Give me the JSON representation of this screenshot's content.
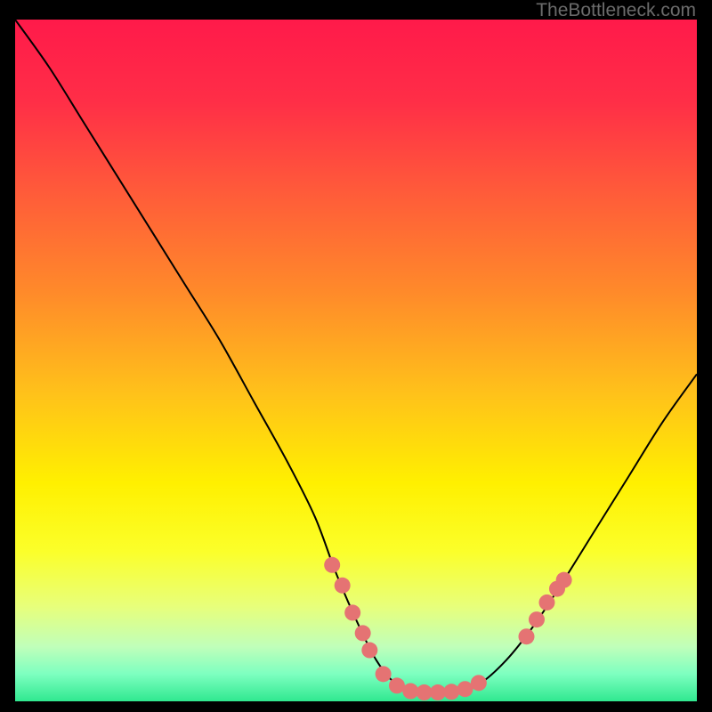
{
  "watermark": "TheBottleneck.com",
  "chart_data": {
    "type": "line",
    "xlim": [
      0,
      100
    ],
    "ylim": [
      0,
      100
    ],
    "curve": [
      {
        "x": 0,
        "y": 100
      },
      {
        "x": 5,
        "y": 93
      },
      {
        "x": 10,
        "y": 85
      },
      {
        "x": 15,
        "y": 77
      },
      {
        "x": 20,
        "y": 69
      },
      {
        "x": 25,
        "y": 61
      },
      {
        "x": 30,
        "y": 53
      },
      {
        "x": 35,
        "y": 44
      },
      {
        "x": 40,
        "y": 35
      },
      {
        "x": 44,
        "y": 27
      },
      {
        "x": 47,
        "y": 19
      },
      {
        "x": 50,
        "y": 12
      },
      {
        "x": 53,
        "y": 6
      },
      {
        "x": 56,
        "y": 2.5
      },
      {
        "x": 60,
        "y": 1.3
      },
      {
        "x": 64,
        "y": 1.3
      },
      {
        "x": 68,
        "y": 2.5
      },
      {
        "x": 72,
        "y": 6
      },
      {
        "x": 76,
        "y": 11
      },
      {
        "x": 80,
        "y": 17
      },
      {
        "x": 85,
        "y": 25
      },
      {
        "x": 90,
        "y": 33
      },
      {
        "x": 95,
        "y": 41
      },
      {
        "x": 100,
        "y": 48
      }
    ],
    "markers": [
      {
        "x": 46.5,
        "y": 20
      },
      {
        "x": 48,
        "y": 17
      },
      {
        "x": 49.5,
        "y": 13
      },
      {
        "x": 51,
        "y": 10
      },
      {
        "x": 52,
        "y": 7.5
      },
      {
        "x": 54,
        "y": 4
      },
      {
        "x": 56,
        "y": 2.3
      },
      {
        "x": 58,
        "y": 1.5
      },
      {
        "x": 60,
        "y": 1.3
      },
      {
        "x": 62,
        "y": 1.3
      },
      {
        "x": 64,
        "y": 1.4
      },
      {
        "x": 66,
        "y": 1.8
      },
      {
        "x": 68,
        "y": 2.7
      },
      {
        "x": 75,
        "y": 9.5
      },
      {
        "x": 76.5,
        "y": 12
      },
      {
        "x": 78,
        "y": 14.5
      },
      {
        "x": 79.5,
        "y": 16.5
      },
      {
        "x": 80.5,
        "y": 17.8
      }
    ],
    "gradient_stops": [
      {
        "offset": 0,
        "color": "#ff1a4a"
      },
      {
        "offset": 12,
        "color": "#ff2e47"
      },
      {
        "offset": 25,
        "color": "#ff5a3a"
      },
      {
        "offset": 40,
        "color": "#ff8a2a"
      },
      {
        "offset": 55,
        "color": "#ffc21a"
      },
      {
        "offset": 68,
        "color": "#fff000"
      },
      {
        "offset": 78,
        "color": "#fbff2a"
      },
      {
        "offset": 86,
        "color": "#e8ff7a"
      },
      {
        "offset": 92,
        "color": "#c0ffba"
      },
      {
        "offset": 96,
        "color": "#7dffc0"
      },
      {
        "offset": 100,
        "color": "#30e890"
      }
    ],
    "marker_color": "#e57373",
    "curve_color": "#000000"
  }
}
